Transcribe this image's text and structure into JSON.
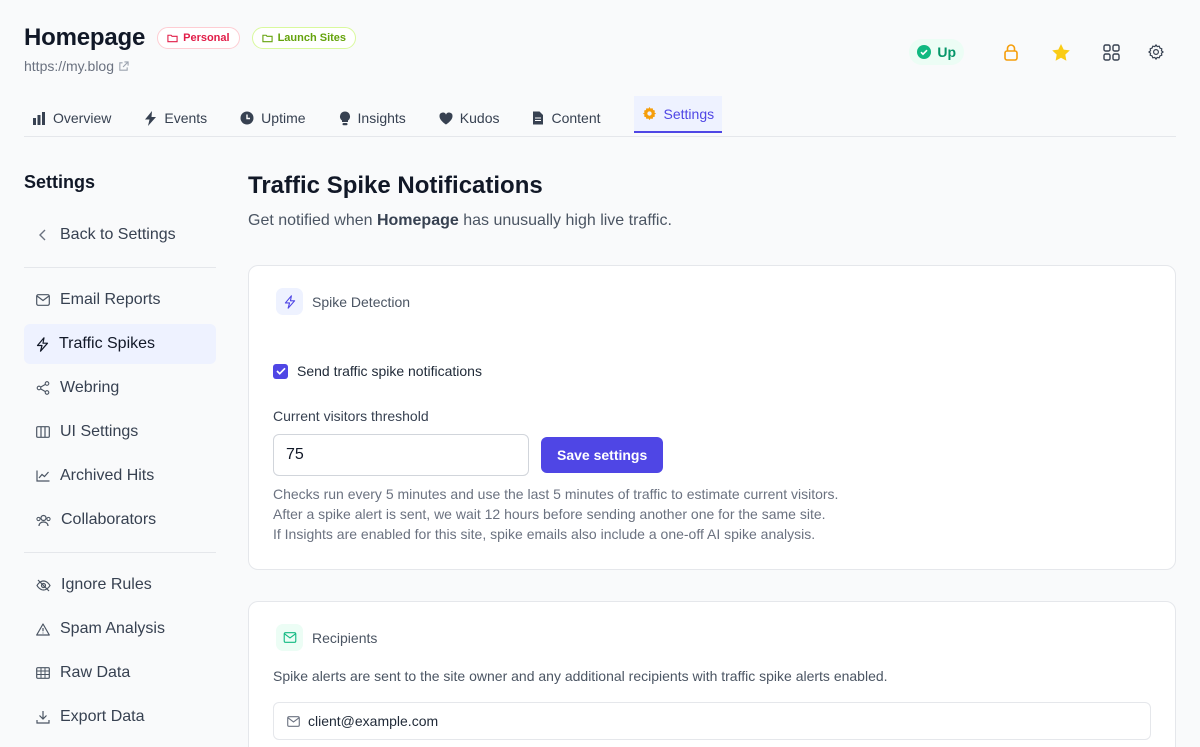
{
  "header": {
    "site_title": "Homepage",
    "tags": [
      "Personal",
      "Launch Sites"
    ],
    "site_url": "https://my.blog",
    "status": "Up"
  },
  "tabs": [
    "Overview",
    "Events",
    "Uptime",
    "Insights",
    "Kudos",
    "Content",
    "Settings"
  ],
  "sidebar": {
    "title": "Settings",
    "back": "Back to Settings",
    "group1": [
      "Email Reports",
      "Traffic Spikes",
      "Webring",
      "UI Settings",
      "Archived Hits",
      "Collaborators"
    ],
    "group2": [
      "Ignore Rules",
      "Spam Analysis",
      "Raw Data",
      "Export Data"
    ]
  },
  "main": {
    "title": "Traffic Spike Notifications",
    "sub_pre": "Get notified when ",
    "sub_site": "Homepage",
    "sub_post": " has unusually high live traffic.",
    "detection": {
      "heading": "Spike Detection",
      "checkbox_label": "Send traffic spike notifications",
      "threshold_label": "Current visitors threshold",
      "threshold_value": "75",
      "save_label": "Save settings",
      "help": [
        "Checks run every 5 minutes and use the last 5 minutes of traffic to estimate current visitors.",
        "After a spike alert is sent, we wait 12 hours before sending another one for the same site.",
        "If Insights are enabled for this site, spike emails also include a one-off AI spike analysis."
      ]
    },
    "recipients": {
      "heading": "Recipients",
      "desc": "Spike alerts are sent to the site owner and any additional recipients with traffic spike alerts enabled.",
      "email": "client@example.com"
    }
  },
  "colors": {
    "accent": "#4f46e5",
    "status_green": "#059669",
    "personal_tag": "#e11d48",
    "launch_tag": "#65a30d",
    "star": "#facc15",
    "lock": "#f59e0b"
  }
}
